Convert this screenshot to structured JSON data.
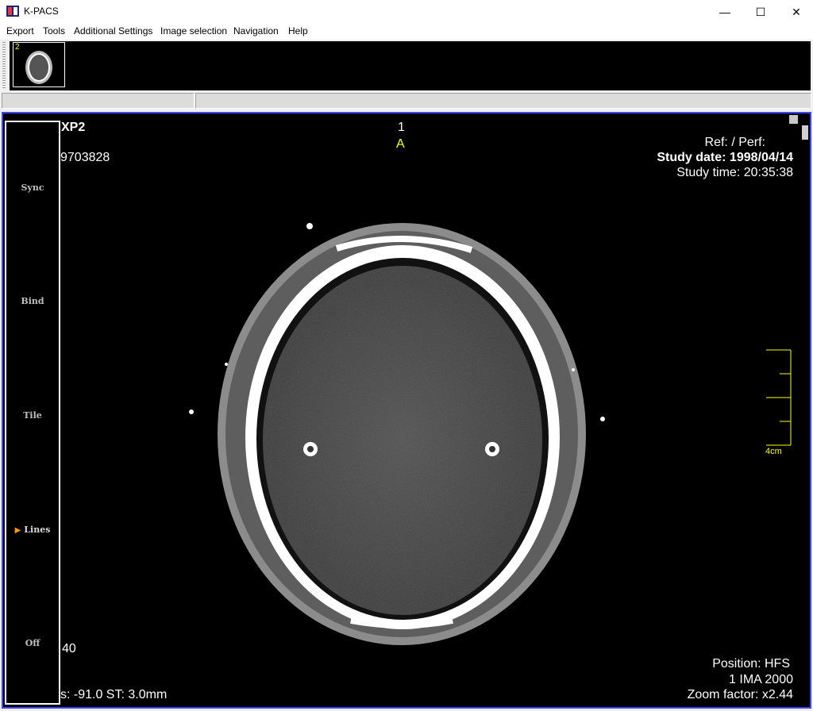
{
  "window": {
    "title": "K-PACS",
    "minimize_glyph": "—",
    "maximize_glyph": "☐",
    "close_glyph": "✕"
  },
  "menu": [
    "Export",
    "Tools",
    "Additional Settings",
    "Image selection",
    "Navigation",
    "Help"
  ],
  "thumbnail": {
    "number": "2"
  },
  "side_panel": {
    "buttons": [
      "Sync",
      "Bind",
      "Tile",
      "Lines",
      "Off"
    ],
    "active_arrow": "▶"
  },
  "overlay": {
    "top_left_1": "XP2",
    "top_left_2": "9703828",
    "top_center_num": "1",
    "top_center_orient": "A",
    "ref_perf": "Ref:  / Perf:",
    "study_date": "Study date: 1998/04/14",
    "study_time": "Study time: 20:35:38",
    "scale_label": "4cm",
    "bottom_left_1": "40",
    "bottom_left_2": "s: -91.0  ST: 3.0mm",
    "position": "Position: HFS",
    "ima": "1 IMA 2000",
    "zoom": "Zoom factor: x2.44"
  },
  "colors": {
    "viewer_border": "#3a46ff",
    "overlay_text": "#ffffff",
    "orientation_text": "#ffff00",
    "active_arrow": "#ff9900"
  }
}
